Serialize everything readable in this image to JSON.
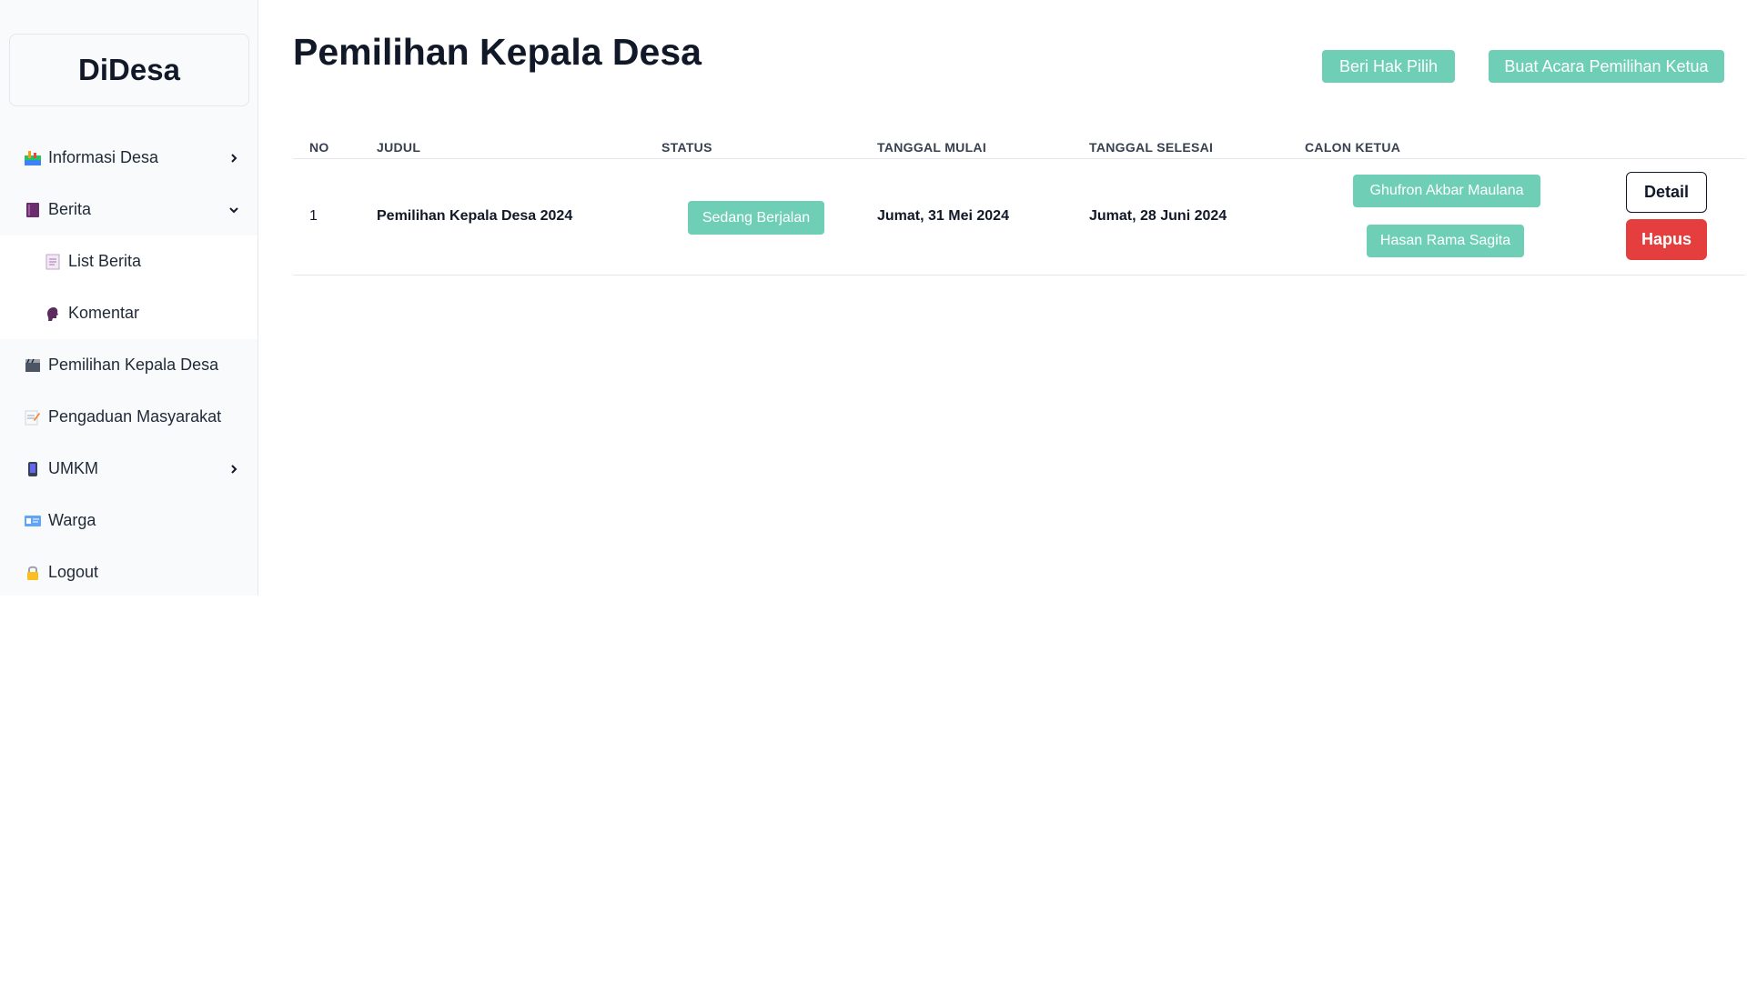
{
  "sidebar": {
    "brand": "DiDesa",
    "items": [
      {
        "label": "Informasi Desa",
        "icon": "map-icon",
        "chevron": "right"
      },
      {
        "label": "Berita",
        "icon": "book-icon",
        "chevron": "down",
        "children": [
          {
            "label": "List Berita",
            "icon": "document-icon"
          },
          {
            "label": "Komentar",
            "icon": "speech-head-icon"
          }
        ]
      },
      {
        "label": "Pemilihan Kepala Desa",
        "icon": "clapperboard-icon"
      },
      {
        "label": "Pengaduan Masyarakat",
        "icon": "memo-icon"
      },
      {
        "label": "UMKM",
        "icon": "phone-icon",
        "chevron": "right"
      },
      {
        "label": "Warga",
        "icon": "id-card-icon"
      },
      {
        "label": "Logout",
        "icon": "lock-icon"
      }
    ]
  },
  "main": {
    "title": "Pemilihan Kepala Desa",
    "actions": {
      "hak_pilih": "Beri Hak Pilih",
      "buat_acara": "Buat Acara Pemilihan Ketua"
    },
    "table": {
      "headers": {
        "no": "NO",
        "judul": "JUDUL",
        "status": "STATUS",
        "tanggal_mulai": "TANGGAL MULAI",
        "tanggal_selesai": "TANGGAL SELESAI",
        "calon_ketua": "CALON KETUA"
      },
      "rows": [
        {
          "no": "1",
          "judul": "Pemilihan Kepala Desa 2024",
          "status": "Sedang Berjalan",
          "tanggal_mulai": "Jumat, 31 Mei 2024",
          "tanggal_selesai": "Jumat, 28 Juni 2024",
          "calon": [
            "Ghufron Akbar Maulana",
            "Hasan Rama Sagita"
          ],
          "detail": "Detail",
          "hapus": "Hapus"
        }
      ]
    }
  },
  "colors": {
    "teal": "#6fcfb6",
    "danger": "#e53e3e",
    "sidebar_bg": "#f9fafb"
  }
}
